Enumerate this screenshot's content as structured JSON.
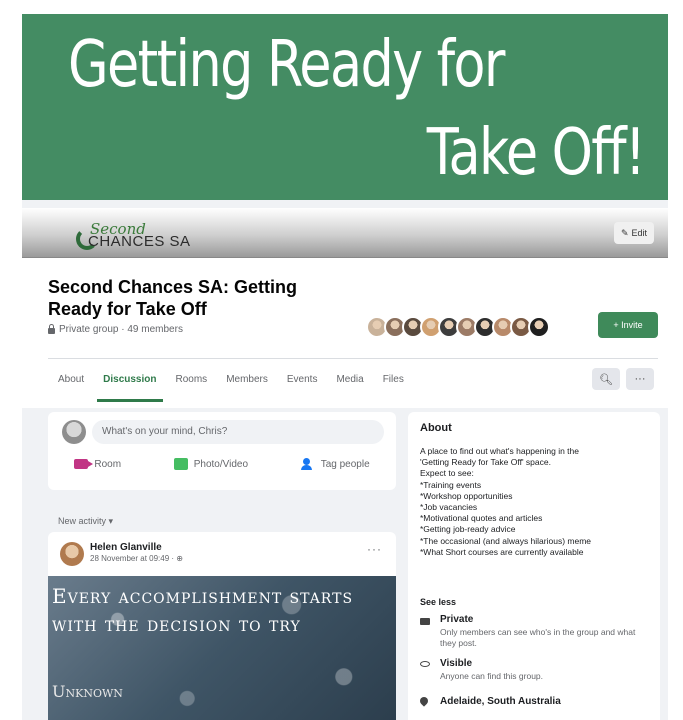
{
  "banner": {
    "line1": "Getting Ready for",
    "line2": "Take Off!"
  },
  "cover": {
    "logo_script": "Second",
    "logo_word": "CHANCES SA",
    "edit_label": "Edit"
  },
  "group": {
    "title": "Second Chances SA: Getting Ready for Take Off",
    "meta": "Private group · 49 members",
    "invite_label": "+ Invite",
    "member_avatar_colors": [
      "#c9b29a",
      "#8a6f5c",
      "#5a4a3e",
      "#d0a070",
      "#3d3d3d",
      "#9c7b66",
      "#2d2d2d",
      "#b88a6a",
      "#7a5a44",
      "#1f1f1f"
    ]
  },
  "tabs": [
    {
      "label": "About",
      "active": false
    },
    {
      "label": "Discussion",
      "active": true
    },
    {
      "label": "Rooms",
      "active": false
    },
    {
      "label": "Members",
      "active": false
    },
    {
      "label": "Events",
      "active": false
    },
    {
      "label": "Media",
      "active": false
    },
    {
      "label": "Files",
      "active": false
    }
  ],
  "toolbar": {
    "search_icon": "search-icon",
    "more_label": "···"
  },
  "composer": {
    "placeholder": "What's on your mind, Chris?",
    "actions": {
      "room": "Room",
      "photo": "Photo/Video",
      "tag": "Tag people"
    }
  },
  "feed": {
    "sort_label": "New activity ▾"
  },
  "post": {
    "author": "Helen Glanville",
    "timestamp": "28 November at 09:49 · ⊕",
    "more": "···",
    "quote": "Every accomplishment starts with the decision to try",
    "quote_source": "Unknown"
  },
  "about": {
    "heading": "About",
    "description_lines": [
      "A place to find out what's happening in the",
      "'Getting Ready for Take Off' space.",
      "Expect to see:",
      "*Training events",
      "*Workshop opportunities",
      "*Job vacancies",
      "*Motivational quotes and articles",
      "*Getting job-ready advice",
      "*The occasional (and always hilarious) meme",
      "*What Short courses are currently available"
    ],
    "see_less": "See less",
    "private_title": "Private",
    "private_sub": "Only members can see who's in the group and what they post.",
    "visible_title": "Visible",
    "visible_sub": "Anyone can find this group.",
    "location": "Adelaide, South Australia"
  }
}
